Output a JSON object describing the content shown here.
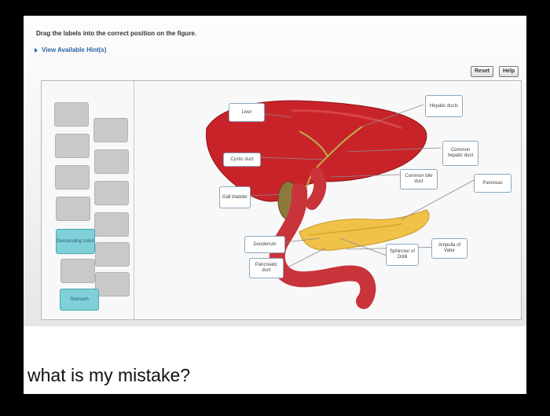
{
  "instructions": "Drag the labels into the correct position on the figure.",
  "hints_link": "View Available Hint(s)",
  "buttons": {
    "reset": "Reset",
    "help": "Help"
  },
  "bank_chips": {
    "descending_colon": "Descending colon",
    "stomach": "Stomach"
  },
  "figure_labels": {
    "liver": "Liver",
    "cystic_duct": "Cystic duct",
    "gall_bladder": "Gall bladder",
    "duodenum": "Duodenum",
    "pancreatic_duct": "Pancreatic duct",
    "hepatic_ducts": "Hepatic ducts",
    "common_hepatic_duct": "Common hepatic duct",
    "common_bile_duct": "Common bile duct",
    "pancreas": "Pancreas",
    "sphincter_of_oddi": "Sphincter of Oddi",
    "ampulla_of_vater": "Ampulla of Vater"
  },
  "question": "what is my mistake?"
}
